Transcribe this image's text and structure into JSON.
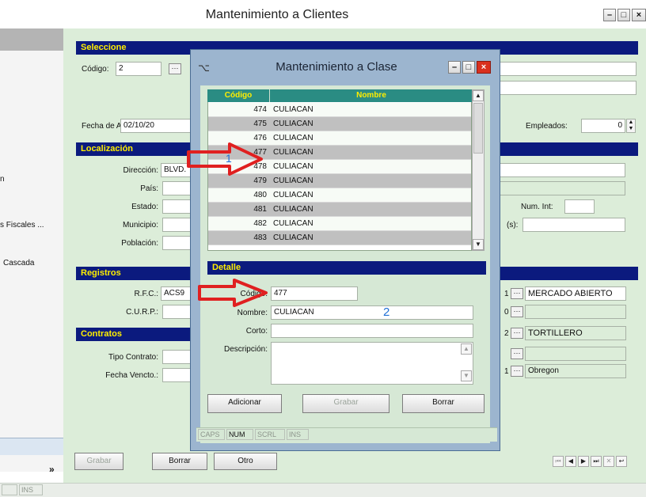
{
  "outer": {
    "title": "Mantenimiento a Clientes",
    "controls": [
      "–",
      "□",
      "×"
    ]
  },
  "left_panel": {
    "items": [
      "n",
      "s Fiscales ...",
      "Cascada"
    ],
    "arrow": "»",
    "status_cells": [
      "",
      "INS"
    ]
  },
  "seleccione": {
    "header": "Seleccione",
    "codigo_label": "Código:",
    "codigo_value": "2",
    "fecha_label": "Fecha de Alta:",
    "fecha_value": "02/10/20",
    "empleados_label": "Empleados:",
    "empleados_value": "0"
  },
  "localizacion": {
    "header": "Localización",
    "direccion_label": "Dirección:",
    "direccion_value": "BLVD.",
    "pais_label": "País:",
    "estado_label": "Estado:",
    "municipio_label": "Municipio:",
    "poblacion_label": "Población:",
    "numint_label": "Num. Int:",
    "dir_right_label": "(s):"
  },
  "registros": {
    "header": "Registros",
    "rfc_label": "R.F.C.:",
    "rfc_value": "ACS9",
    "curp_label": "C.U.R.P.:"
  },
  "contratos": {
    "header": "Contratos",
    "tipo_label": "Tipo Contrato:",
    "fecha_label": "Fecha Vencto.:"
  },
  "right_fields": [
    {
      "num": "1",
      "text": "MERCADO ABIERTO"
    },
    {
      "num": "0",
      "text": ""
    },
    {
      "num": "2",
      "text": "TORTILLERO"
    },
    {
      "num": "",
      "text": ""
    },
    {
      "num": "1",
      "text": "Obregon"
    }
  ],
  "bottom_buttons": {
    "grabar": "Grabar",
    "borrar": "Borrar",
    "otro": "Otro"
  },
  "nav": [
    "⏮",
    "◀",
    "▶",
    "⏭",
    "✕",
    "↩"
  ],
  "dialog": {
    "title": "Mantenimiento a Clase",
    "controls": [
      "–",
      "□",
      "×"
    ],
    "grid_headers": [
      "Código",
      "Nombre"
    ],
    "rows": [
      {
        "codigo": "474",
        "nombre": "CULIACAN"
      },
      {
        "codigo": "475",
        "nombre": "CULIACAN"
      },
      {
        "codigo": "476",
        "nombre": "CULIACAN"
      },
      {
        "codigo": "477",
        "nombre": "CULIACAN"
      },
      {
        "codigo": "478",
        "nombre": "CULIACAN"
      },
      {
        "codigo": "479",
        "nombre": "CULIACAN"
      },
      {
        "codigo": "480",
        "nombre": "CULIACAN"
      },
      {
        "codigo": "481",
        "nombre": "CULIACAN"
      },
      {
        "codigo": "482",
        "nombre": "CULIACAN"
      },
      {
        "codigo": "483",
        "nombre": "CULIACAN"
      }
    ],
    "detalle_header": "Detalle",
    "codigo_label": "Código:",
    "codigo_value": "477",
    "nombre_label": "Nombre:",
    "nombre_value": "CULIACAN",
    "corto_label": "Corto:",
    "corto_value": "",
    "descripcion_label": "Descripción:",
    "descripcion_value": "",
    "btn_adicionar": "Adicionar",
    "btn_grabar": "Grabar",
    "btn_borrar": "Borrar",
    "status": [
      "CAPS",
      "NUM",
      "SCRL",
      "INS"
    ]
  },
  "annotations": {
    "label1": "1",
    "label2": "2",
    "arrow_color": "#e02020",
    "number_color": "#1f6fd6"
  },
  "colors": {
    "section_bar": "#0b1a7e",
    "section_text": "#ffee00",
    "form_bg": "#dcedd9",
    "grid_header": "#2a8c83",
    "grid_alt_row": "#c0c0c0"
  }
}
